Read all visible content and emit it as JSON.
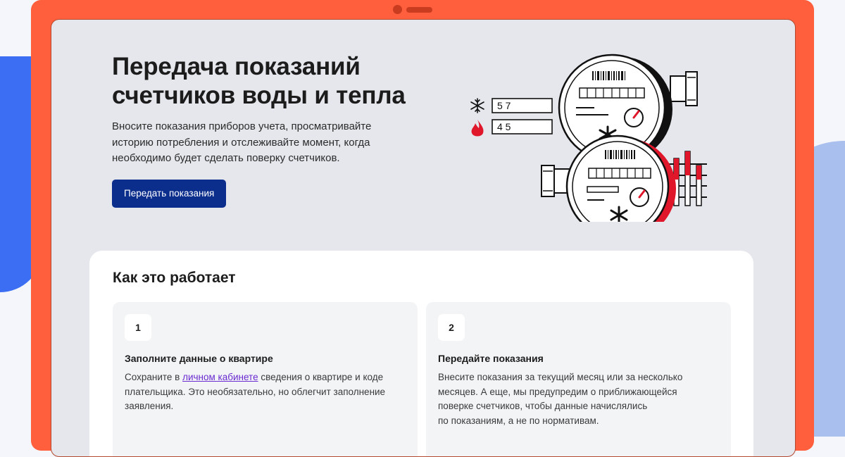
{
  "hero": {
    "title_line1": "Передача показаний",
    "title_line2": "счетчиков воды и тепла",
    "description_line1": "Вносите показания приборов учета, просматривайте",
    "description_line2": "историю потребления и отслеживайте момент, когда",
    "description_line3": "необходимо будет сделать поверку счетчиков.",
    "button_label": "Передать показания"
  },
  "illustration": {
    "cold_value": "5 7",
    "hot_value": "4 5",
    "cold_icon": "snowflake-icon",
    "hot_icon": "flame-icon"
  },
  "how_it_works": {
    "title": "Как это работает",
    "steps": [
      {
        "number": "1",
        "title": "Заполните данные о квартире",
        "text_before_link": "Сохраните в ",
        "link_text": "личном кабинете",
        "text_after_link_line1": " сведения о квартире и коде",
        "text_line2": "плательщика. Это необязательно, но облегчит заполнение",
        "text_line3": "заявления."
      },
      {
        "number": "2",
        "title": "Передайте показания",
        "text_line1": "Внесите показания за текущий месяц или за несколько",
        "text_line2": "месяцев. А еще, мы предупредим о приближающейся",
        "text_line3": "поверке счетчиков, чтобы данные начислялись",
        "text_line4": "по показаниям, а не по нормативам."
      }
    ]
  },
  "colors": {
    "frame": "#ff5f3d",
    "screen": "#e5e7ec",
    "primary_button": "#0b2e8c",
    "accent_red": "#e0162b",
    "link": "#6a2bd0"
  }
}
